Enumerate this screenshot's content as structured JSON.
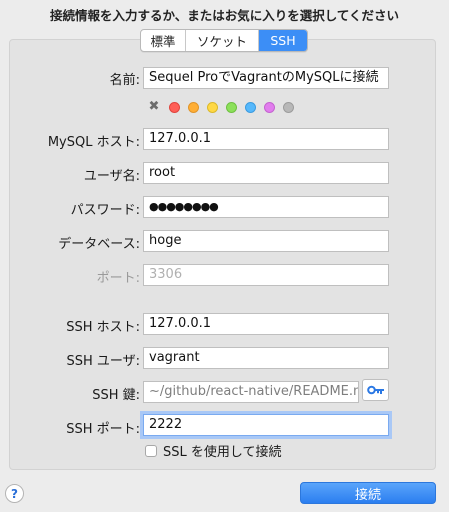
{
  "header": {
    "title": "接続情報を入力するか、またはお気に入りを選択してください"
  },
  "tabs": [
    {
      "label": "標準",
      "active": false
    },
    {
      "label": "ソケット",
      "active": false
    },
    {
      "label": "SSH",
      "active": true
    }
  ],
  "color_tags": [
    "#ff5f57",
    "#ffae35",
    "#ffd845",
    "#8ce05a",
    "#56b8fb",
    "#e17ded",
    "#b8b8b8"
  ],
  "form": {
    "name_label": "名前:",
    "name_value": "Sequel ProでVagrantのMySQLに接続",
    "host_label": "MySQL ホスト:",
    "host_value": "127.0.0.1",
    "user_label": "ユーザ名:",
    "user_value": "root",
    "password_label": "パスワード:",
    "password_value": "●●●●●●●●",
    "database_label": "データベース:",
    "database_value": "hoge",
    "port_label": "ポート:",
    "port_placeholder": "3306",
    "ssh_host_label": "SSH ホスト:",
    "ssh_host_value": "127.0.0.1",
    "ssh_user_label": "SSH ユーザ:",
    "ssh_user_value": "vagrant",
    "ssh_key_label": "SSH 鍵:",
    "ssh_key_value": "~/github/react-native/README.md",
    "ssh_port_label": "SSH ポート:",
    "ssh_port_value": "2222",
    "ssl_label": "SSL を使用して接続"
  },
  "footer": {
    "help_label": "?",
    "connect_label": "接続"
  },
  "colors": {
    "accent": "#3c8ef6",
    "focus_ring": "#a9c8f6"
  }
}
